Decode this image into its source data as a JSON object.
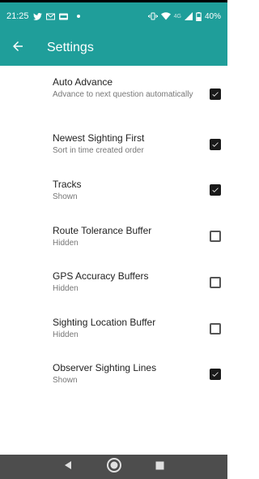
{
  "status_bar": {
    "time": "21:25",
    "network_label": "4G",
    "battery": "40%"
  },
  "app_bar": {
    "title": "Settings"
  },
  "settings": [
    {
      "title": "Auto Advance",
      "subtitle": "Advance to next question automatically",
      "checked": true
    },
    {
      "title": "Newest Sighting First",
      "subtitle": "Sort in time created order",
      "checked": true
    },
    {
      "title": "Tracks",
      "subtitle": "Shown",
      "checked": true
    },
    {
      "title": "Route Tolerance Buffer",
      "subtitle": "Hidden",
      "checked": false
    },
    {
      "title": "GPS Accuracy Buffers",
      "subtitle": "Hidden",
      "checked": false
    },
    {
      "title": "Sighting Location Buffer",
      "subtitle": "Hidden",
      "checked": false
    },
    {
      "title": "Observer Sighting Lines",
      "subtitle": "Shown",
      "checked": true
    }
  ],
  "icons": {
    "back": "arrow-left-icon",
    "twitter": "twitter-icon",
    "mail": "mail-icon",
    "vibrate": "vibrate-icon",
    "wifi": "wifi-icon",
    "signal": "signal-icon",
    "battery": "battery-icon",
    "nav_back": "nav-back-icon",
    "nav_home": "nav-home-icon",
    "nav_recents": "nav-recents-icon"
  },
  "colors": {
    "accent": "#1f9e9a",
    "nav_bar": "#4d4d4d",
    "checkbox_checked": "#1a1a1a"
  }
}
